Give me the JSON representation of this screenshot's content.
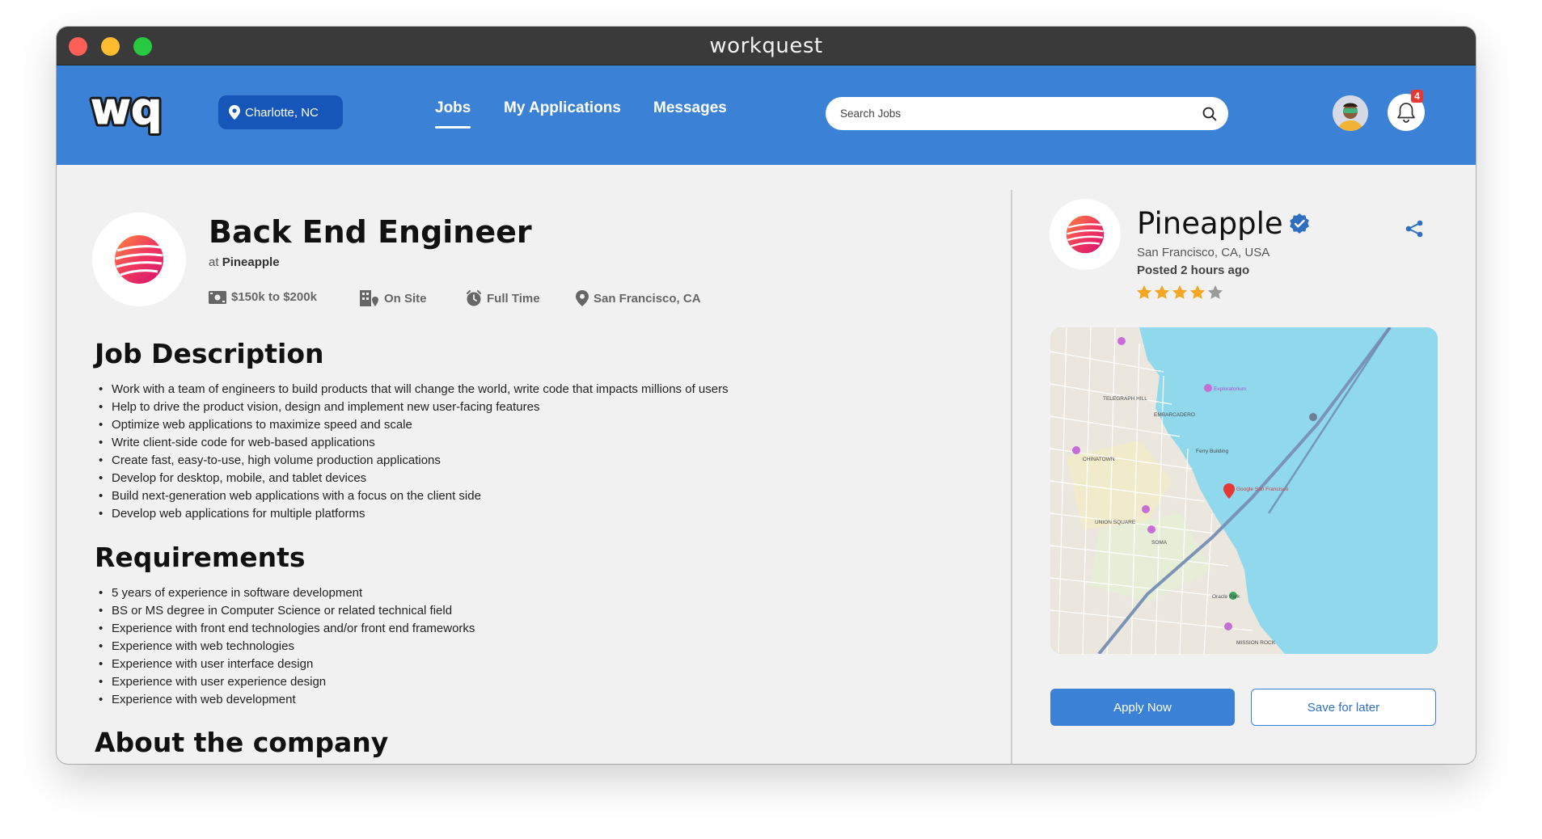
{
  "window": {
    "title": "workquest"
  },
  "navbar": {
    "logo_text": "wq",
    "location": "Charlotte, NC",
    "links": [
      {
        "label": "Jobs",
        "active": true
      },
      {
        "label": "My Applications",
        "active": false
      },
      {
        "label": "Messages",
        "active": false
      }
    ],
    "search_placeholder": "Search Jobs",
    "notification_count": "4"
  },
  "job": {
    "title": "Back End Engineer",
    "at_prefix": "at",
    "company": "Pineapple",
    "meta": {
      "salary": "$150k to $200k",
      "workplace": "On Site",
      "type": "Full Time",
      "location": "San Francisco, CA"
    },
    "description_heading": "Job Description",
    "description": [
      "Work with a team of engineers to build products that will change the world, write code that impacts millions of users",
      "Help to drive the product vision, design and implement new user-facing features",
      "Optimize web applications to maximize speed and scale",
      "Write client-side code for web-based applications",
      "Create fast, easy-to-use, high volume production applications",
      "Develop for desktop, mobile, and tablet devices",
      "Build next-generation web applications with a focus on the client side",
      "Develop web applications for multiple platforms"
    ],
    "requirements_heading": "Requirements",
    "requirements": [
      "5 years of experience in software development",
      "BS or MS degree in Computer Science or related technical field",
      "Experience with front end technologies and/or front end frameworks",
      "Experience with web technologies",
      "Experience with user interface design",
      "Experience with user experience design",
      "Experience with web development"
    ],
    "about_heading": "About the company"
  },
  "company_card": {
    "name": "Pineapple",
    "location": "San Francisco, CA, USA",
    "posted": "Posted 2 hours ago",
    "rating": 4,
    "rating_max": 5,
    "map_labels": {
      "embarcadero": "EMBARCADERO",
      "union_square": "UNION SQUARE",
      "soma": "SOMA",
      "chinatown": "CHINATOWN",
      "telegraph_hill": "TELEGRAPH HILL",
      "mission_rock": "MISSION ROCK",
      "ferry": "Ferry Building",
      "exploratorium": "Exploratorium",
      "oracle": "Oracle Park",
      "google": "Google San Francisco"
    },
    "apply_label": "Apply Now",
    "save_label": "Save for later"
  },
  "colors": {
    "brand_blue": "#3b82d6",
    "pill_blue": "#1656b8",
    "star": "#f5a623",
    "badge_red": "#e53935"
  }
}
